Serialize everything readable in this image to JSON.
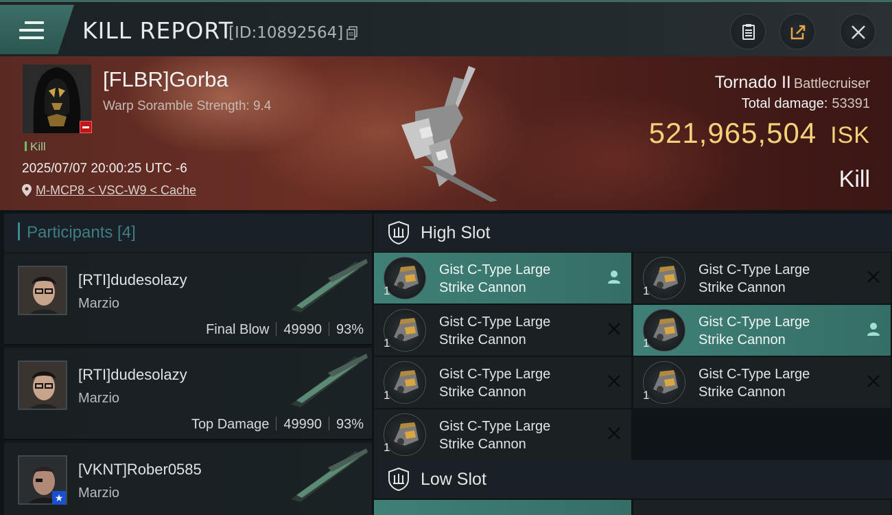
{
  "header": {
    "title": "KILL REPORT",
    "kill_id": "[ID:10892564]"
  },
  "victim": {
    "name": "[FLBR]Gorba",
    "scramble": "Warp Soramble Strength: 9.4",
    "tag": "Kill",
    "datetime": "2025/07/07 20:00:25 UTC -6",
    "location": "M-MCP8 < VSC-W9 < Cache",
    "ship_name": "Tornado II",
    "ship_class": "Battlecruiser",
    "total_damage_label": "Total damage:",
    "total_damage": "53391",
    "isk_value": "521,965,504",
    "isk_unit": "ISK",
    "result": "Kill"
  },
  "participants": {
    "title": "Participants [4]",
    "rows": [
      {
        "name": "[RTI]dudesolazy",
        "ship": "Marzio",
        "stat_label": "Final Blow",
        "damage": "49990",
        "percent": "93%"
      },
      {
        "name": "[RTI]dudesolazy",
        "ship": "Marzio",
        "stat_label": "Top Damage",
        "damage": "49990",
        "percent": "93%"
      },
      {
        "name": "[VKNT]Rober0585",
        "ship": "Marzio"
      }
    ]
  },
  "slots": {
    "high_label": "High Slot",
    "low_label": "Low Slot",
    "high_modules": [
      {
        "name_line1": "Gist C-Type Large",
        "name_line2": "Strike Cannon",
        "qty": "1",
        "status": "dropped"
      },
      {
        "name_line1": "Gist C-Type Large",
        "name_line2": "Strike Cannon",
        "qty": "1",
        "status": "destroyed"
      },
      {
        "name_line1": "Gist C-Type Large",
        "name_line2": "Strike Cannon",
        "qty": "1",
        "status": "destroyed"
      },
      {
        "name_line1": "Gist C-Type Large",
        "name_line2": "Strike Cannon",
        "qty": "1",
        "status": "dropped"
      },
      {
        "name_line1": "Gist C-Type Large",
        "name_line2": "Strike Cannon",
        "qty": "1",
        "status": "destroyed"
      },
      {
        "name_line1": "Gist C-Type Large",
        "name_line2": "Strike Cannon",
        "qty": "1",
        "status": "destroyed"
      },
      {
        "name_line1": "Gist C-Type Large",
        "name_line2": "Strike Cannon",
        "qty": "1",
        "status": "destroyed"
      }
    ]
  },
  "colors": {
    "accent_teal": "#3f8076",
    "isk_gold": "#f5d27a",
    "corp_badge_red": "#c01818"
  },
  "icons": {
    "menu": "hamburger-icon",
    "copy": "copy-icon",
    "clipboard": "clipboard-icon",
    "share": "share-icon",
    "close": "close-icon",
    "pin": "location-pin-icon",
    "shield": "slot-shield-icon",
    "dropped": "person-icon",
    "destroyed": "x-icon"
  }
}
